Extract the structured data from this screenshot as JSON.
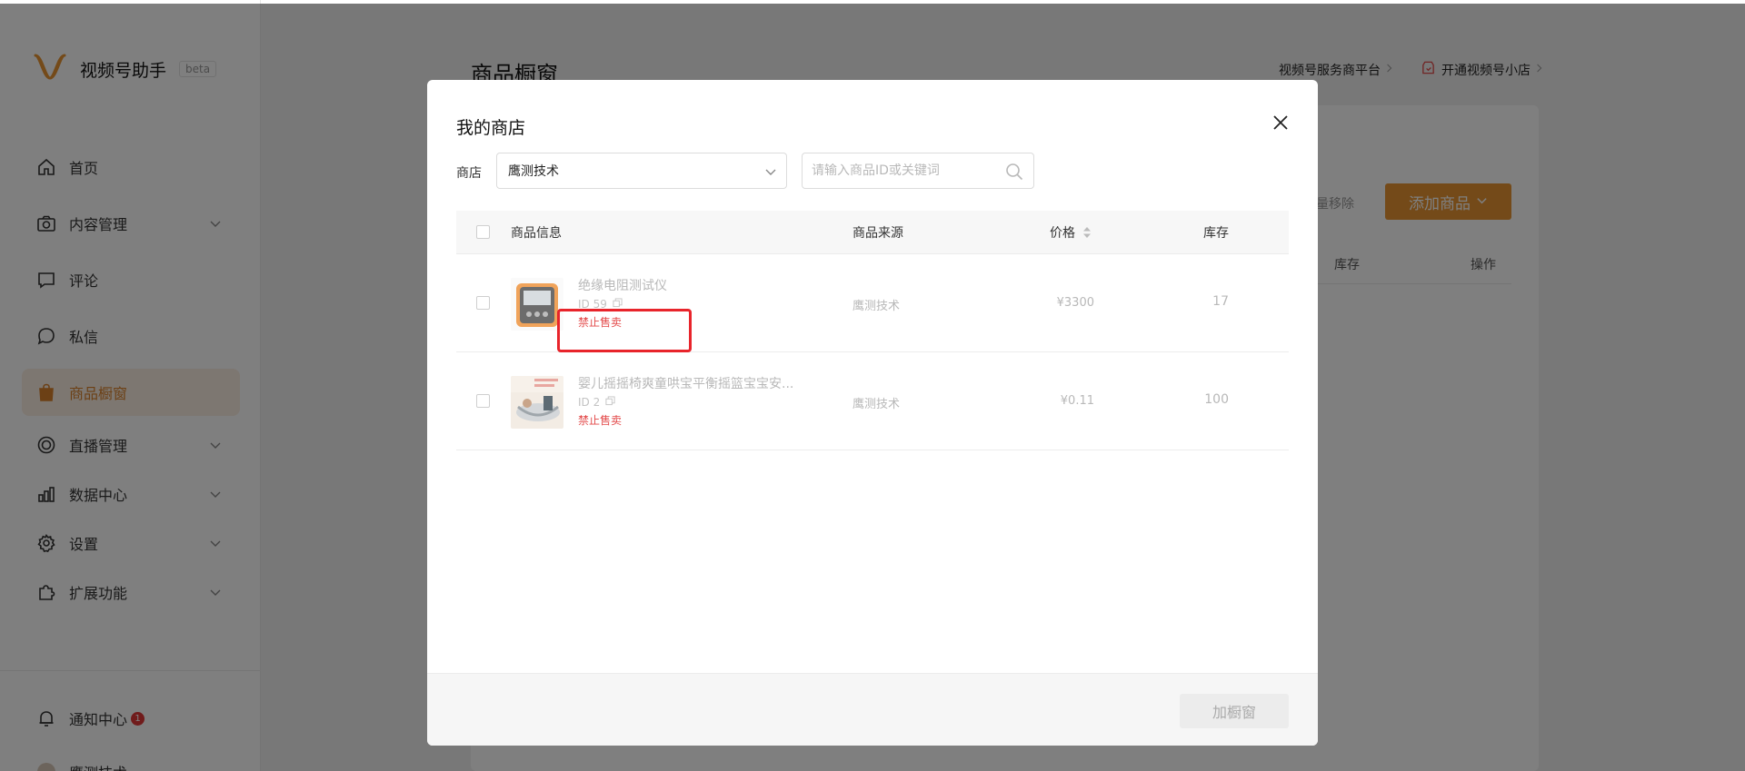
{
  "app": {
    "brand": "视频号助手",
    "badge": "beta"
  },
  "sidebar": {
    "items": [
      {
        "label": "首页",
        "icon": "home-icon"
      },
      {
        "label": "内容管理",
        "icon": "camera-icon",
        "expandable": true
      },
      {
        "label": "评论",
        "icon": "comment-icon"
      },
      {
        "label": "私信",
        "icon": "message-icon"
      },
      {
        "label": "商品橱窗",
        "icon": "shopping-bag-icon",
        "active": true
      },
      {
        "label": "直播管理",
        "icon": "live-icon",
        "expandable": true
      },
      {
        "label": "数据中心",
        "icon": "chart-icon",
        "expandable": true
      },
      {
        "label": "设置",
        "icon": "gear-icon",
        "expandable": true
      },
      {
        "label": "扩展功能",
        "icon": "puzzle-icon",
        "expandable": true
      }
    ],
    "notifications": {
      "label": "通知中心",
      "count": "1"
    },
    "account_partial": "鹰测技术"
  },
  "page": {
    "title": "商品橱窗",
    "top_links": [
      {
        "label": "视频号服务商平台"
      },
      {
        "label": "开通视频号小店"
      }
    ],
    "batch_remove": "量移除",
    "add_product": "添加商品",
    "bg_columns": [
      "库存",
      "操作"
    ]
  },
  "modal": {
    "title": "我的商店",
    "store_label": "商店",
    "store_value": "鹰测技术",
    "search_placeholder": "请输入商品ID或关键词",
    "columns": {
      "info": "商品信息",
      "source": "商品来源",
      "price": "价格",
      "stock": "库存"
    },
    "rows": [
      {
        "name": "绝缘电阻测试仪",
        "id": "ID 59",
        "status": "禁止售卖",
        "source": "鹰测技术",
        "price": "¥3300",
        "stock": "17"
      },
      {
        "name": "婴儿摇摇椅爽童哄宝平衡摇篮宝宝安...",
        "id": "ID 2",
        "status": "禁止售卖",
        "source": "鹰测技术",
        "price": "¥0.11",
        "stock": "100"
      }
    ],
    "add_button": "加橱窗"
  },
  "colors": {
    "accent": "#e89533",
    "active_bg": "#fbeee2",
    "danger": "#e34a4a",
    "highlight": "#e8242b"
  }
}
